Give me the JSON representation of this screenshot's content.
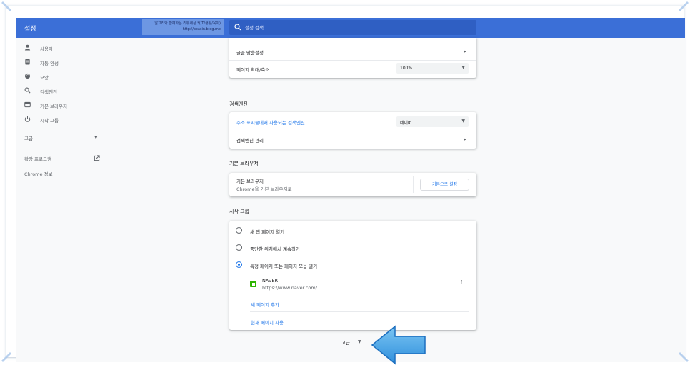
{
  "header": {
    "title": "설정",
    "watermark_line1": "알고리와 함께하는 리뷰세상 *(IT/생활/육아)",
    "watermark_line2": "http://pcasin.blog.me",
    "search_placeholder": "설정 검색"
  },
  "sidebar": {
    "items": [
      {
        "label": "사용자",
        "icon": "person-icon"
      },
      {
        "label": "자동 완성",
        "icon": "autofill-icon"
      },
      {
        "label": "모양",
        "icon": "palette-icon"
      },
      {
        "label": "검색엔진",
        "icon": "search-icon"
      },
      {
        "label": "기본 브라우저",
        "icon": "browser-icon"
      },
      {
        "label": "시작 그룹",
        "icon": "power-icon"
      }
    ],
    "advanced_label": "고급",
    "extensions_label": "확장 프로그램",
    "about_label": "Chrome 정보"
  },
  "appearance": {
    "font_settings_label": "글꼴 맞춤설정",
    "zoom_label": "페이지 확대/축소",
    "zoom_value": "100%"
  },
  "search_engine": {
    "section_title": "검색엔진",
    "address_bar_label": "주소 표시줄에서 사용되는 검색엔진",
    "engine_value": "네이버",
    "manage_label": "검색엔진 관리"
  },
  "default_browser": {
    "section_title": "기본 브라우저",
    "label": "기본 브라우저",
    "sub_label": "Chrome을 기본 브라우저로",
    "button_label": "기본으로 설정"
  },
  "startup": {
    "section_title": "시작 그룹",
    "options": [
      {
        "label": "새 탭 페이지 열기",
        "selected": false
      },
      {
        "label": "중단한 위치에서 계속하기",
        "selected": false
      },
      {
        "label": "특정 페이지 또는 페이지 모음 열기",
        "selected": true
      }
    ],
    "page": {
      "name": "NAVER",
      "url": "https://www.naver.com/"
    },
    "add_page_label": "새 페이지 추가",
    "use_current_label": "현재 페이지 사용"
  },
  "footer": {
    "advanced_label": "고급"
  },
  "colors": {
    "header": "#3b6fd7",
    "accent": "#1a73e8",
    "arrow": "#3da5e8"
  }
}
